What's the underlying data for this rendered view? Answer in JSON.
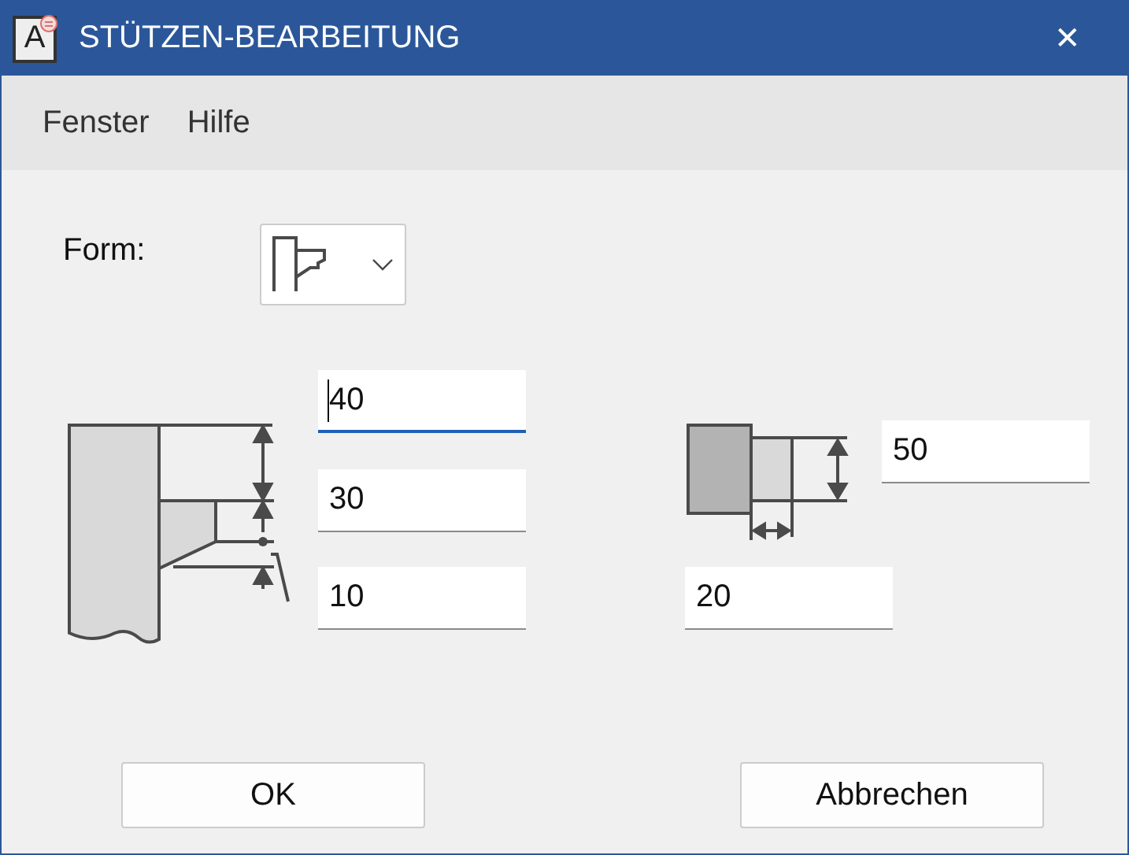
{
  "window": {
    "icon_letter": "A",
    "title": "STÜTZEN-BEARBEITUNG",
    "close": "✕"
  },
  "menu": [
    "Fenster",
    "Hilfe"
  ],
  "form": {
    "label": "Form:"
  },
  "left_fields": [
    {
      "value": "40",
      "focused": true
    },
    {
      "value": "30",
      "focused": false
    },
    {
      "value": "10",
      "focused": false
    }
  ],
  "right_fields": [
    {
      "value": "50",
      "focused": false
    },
    {
      "value": "20",
      "focused": false
    }
  ],
  "buttons": [
    "OK",
    "Abbrechen"
  ]
}
